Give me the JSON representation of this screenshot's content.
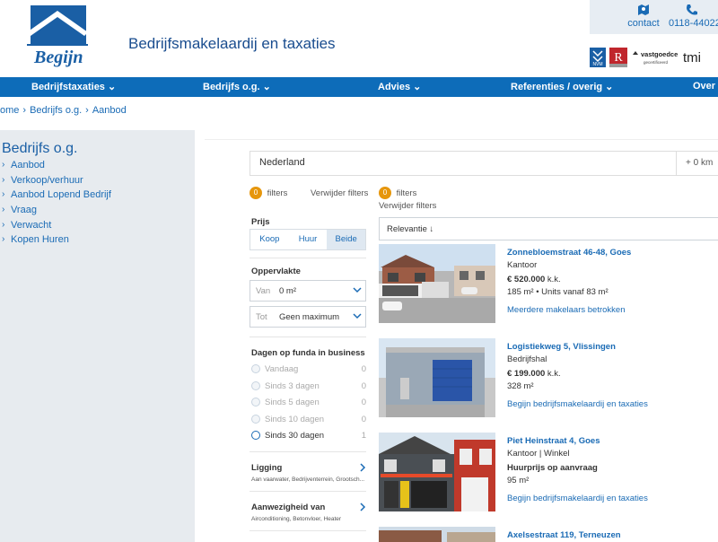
{
  "header": {
    "logo_text": "Begijn",
    "site_title": "Bedrijfsmakelaardij en taxaties",
    "contact_label": "contact",
    "phone": "0118-44022",
    "badges": [
      "NVM",
      "R",
      "vastgoedcert",
      "tmi"
    ]
  },
  "nav": {
    "items": [
      {
        "label": "Bedrijfstaxaties"
      },
      {
        "label": "Bedrijfs o.g."
      },
      {
        "label": "Advies"
      },
      {
        "label": "Referenties / overig"
      },
      {
        "label": "Over"
      }
    ]
  },
  "breadcrumb": [
    "ome",
    "Bedrijfs o.g.",
    "Aanbod"
  ],
  "sidebar": {
    "title": "Bedrijfs o.g.",
    "items": [
      "Aanbod",
      "Verkoop/verhuur",
      "Aanbod Lopend Bedrijf",
      "Vraag",
      "Verwacht",
      "Kopen Huren"
    ]
  },
  "search": {
    "value": "Nederland",
    "radius": "+ 0 km"
  },
  "filters": {
    "count": "0",
    "label": "filters",
    "clear": "Verwijder filters",
    "count2": "0",
    "label2": "filters",
    "clear2": "Verwijder filters",
    "prijs": {
      "heading": "Prijs",
      "options": [
        "Koop",
        "Huur",
        "Beide"
      ],
      "selected": "Beide"
    },
    "oppervlakte": {
      "heading": "Oppervlakte",
      "van_label": "Van",
      "van_value": "0 m²",
      "tot_label": "Tot",
      "tot_value": "Geen maximum"
    },
    "dagen": {
      "heading": "Dagen op funda in business",
      "options": [
        {
          "label": "Vandaag",
          "count": "0"
        },
        {
          "label": "Sinds 3 dagen",
          "count": "0"
        },
        {
          "label": "Sinds 5 dagen",
          "count": "0"
        },
        {
          "label": "Sinds 10 dagen",
          "count": "0"
        },
        {
          "label": "Sinds 30 dagen",
          "count": "1"
        }
      ]
    },
    "ligging": {
      "heading": "Ligging",
      "sub": "Aan vaarwater, Bedrijventerrein, Grootsch..."
    },
    "aanwezigheid": {
      "heading": "Aanwezigheid van",
      "sub": "Airconditioning, Betonvloer, Heater"
    }
  },
  "sort": {
    "label": "Relevantie ↓"
  },
  "listings": [
    {
      "address": "Zonnebloemstraat 46-48, Goes",
      "type": "Kantoor",
      "price": "€ 520.000",
      "price_suffix": "k.k.",
      "area": "185 m²  •  Units vanaf 83 m²",
      "agent": "Meerdere makelaars betrokken"
    },
    {
      "address": "Logistiekweg 5, Vlissingen",
      "type": "Bedrijfshal",
      "price": "€ 199.000",
      "price_suffix": "k.k.",
      "area": "328 m²",
      "agent": "Begijn bedrijfsmakelaardij en taxaties"
    },
    {
      "address": "Piet Heinstraat 4, Goes",
      "type": "Kantoor  |  Winkel",
      "price": "Huurprijs op aanvraag",
      "price_suffix": "",
      "area": "95 m²",
      "agent": "Begijn bedrijfsmakelaardij en taxaties"
    },
    {
      "address": "Axelsestraat 119, Terneuzen",
      "type": "",
      "price": "",
      "price_suffix": "",
      "area": "",
      "agent": ""
    }
  ],
  "colors": {
    "brand_blue": "#0d6cb9",
    "link": "#1a6bb5",
    "badge_orange": "#e6960c",
    "sidebar_bg": "#e7ebef"
  }
}
